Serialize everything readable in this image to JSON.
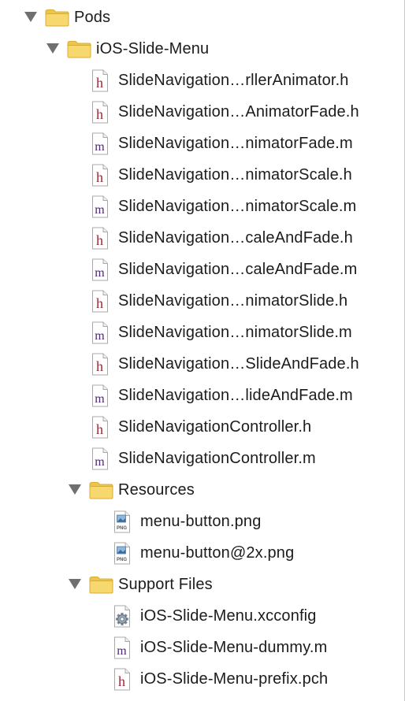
{
  "navigator": {
    "root": {
      "label": "Pods",
      "icon": "folder-icon",
      "expanded": true,
      "children": [
        {
          "label": "iOS-Slide-Menu",
          "icon": "folder-icon",
          "expanded": true,
          "files": [
            {
              "label": "SlideNavigation…rllerAnimator.h",
              "icon": "header-file-icon",
              "glyph": "h"
            },
            {
              "label": "SlideNavigation…AnimatorFade.h",
              "icon": "header-file-icon",
              "glyph": "h"
            },
            {
              "label": "SlideNavigation…nimatorFade.m",
              "icon": "source-file-icon",
              "glyph": "m"
            },
            {
              "label": "SlideNavigation…nimatorScale.h",
              "icon": "header-file-icon",
              "glyph": "h"
            },
            {
              "label": "SlideNavigation…nimatorScale.m",
              "icon": "source-file-icon",
              "glyph": "m"
            },
            {
              "label": "SlideNavigation…caleAndFade.h",
              "icon": "header-file-icon",
              "glyph": "h"
            },
            {
              "label": "SlideNavigation…caleAndFade.m",
              "icon": "source-file-icon",
              "glyph": "m"
            },
            {
              "label": "SlideNavigation…nimatorSlide.h",
              "icon": "header-file-icon",
              "glyph": "h"
            },
            {
              "label": "SlideNavigation…nimatorSlide.m",
              "icon": "source-file-icon",
              "glyph": "m"
            },
            {
              "label": "SlideNavigation…SlideAndFade.h",
              "icon": "header-file-icon",
              "glyph": "h"
            },
            {
              "label": "SlideNavigation…lideAndFade.m",
              "icon": "source-file-icon",
              "glyph": "m"
            },
            {
              "label": "SlideNavigationController.h",
              "icon": "header-file-icon",
              "glyph": "h"
            },
            {
              "label": "SlideNavigationController.m",
              "icon": "source-file-icon",
              "glyph": "m"
            }
          ],
          "groups": [
            {
              "label": "Resources",
              "icon": "folder-icon",
              "expanded": true,
              "files": [
                {
                  "label": "menu-button.png",
                  "icon": "png-file-icon",
                  "glyph": "PNG"
                },
                {
                  "label": "menu-button@2x.png",
                  "icon": "png-file-icon",
                  "glyph": "PNG"
                }
              ]
            },
            {
              "label": "Support Files",
              "icon": "folder-icon",
              "expanded": true,
              "files": [
                {
                  "label": "iOS-Slide-Menu.xcconfig",
                  "icon": "xcconfig-file-icon",
                  "glyph": ""
                },
                {
                  "label": "iOS-Slide-Menu-dummy.m",
                  "icon": "source-file-icon",
                  "glyph": "m"
                },
                {
                  "label": "iOS-Slide-Menu-prefix.pch",
                  "icon": "header-file-icon",
                  "glyph": "h"
                }
              ]
            }
          ]
        }
      ]
    }
  },
  "colors": {
    "folder": "#f6d86f",
    "folder_tab": "#ecc64b",
    "folder_edge": "#d8ad34",
    "disclosure": "#6f6f6f",
    "header_glyph": "#9d2538",
    "source_glyph": "#4d2a6e",
    "text": "#1c1c1c"
  }
}
